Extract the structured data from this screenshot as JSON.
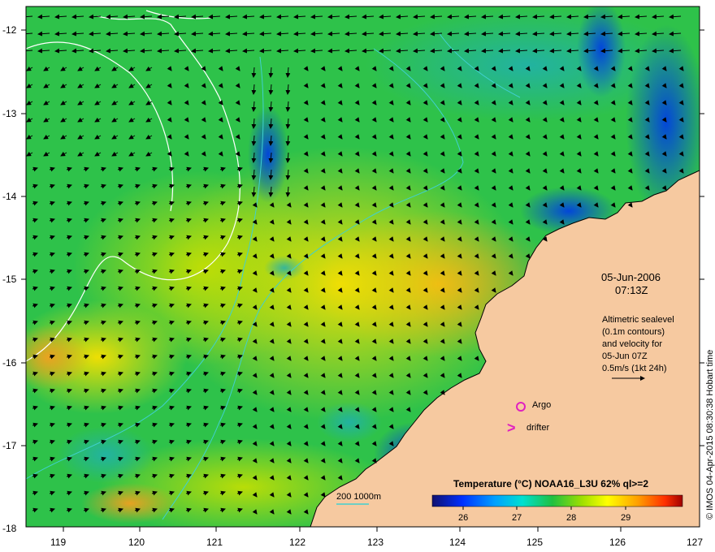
{
  "map": {
    "lat_ticks": [
      "-12",
      "-13",
      "-14",
      "-15",
      "-16",
      "-17",
      "-18"
    ],
    "lon_ticks": [
      "119",
      "120",
      "121",
      "122",
      "123",
      "124",
      "125",
      "126",
      "127"
    ],
    "date": "05-Jun-2006",
    "time": "07:13Z",
    "info_lines": [
      "Altimetric sealevel",
      "(0.1m contours)",
      "and velocity for",
      "05-Jun 07Z",
      "0.5m/s (1kt 24h)"
    ],
    "argo_label": "Argo",
    "drifter_label": "drifter",
    "depth_legend": "200  1000m",
    "colorbar_title": "Temperature (°C) NOAA16_L3U 62% ql>=2",
    "colorbar_ticks": [
      "26",
      "27",
      "28",
      "29"
    ],
    "credit": "© IMOS 04-Apr-2015 08:30:38 Hobart time",
    "colors": {
      "land": "#f6c9a0",
      "argo": "#e020c0",
      "drifter": "#e020c0",
      "depth_contour": "#40d0d0",
      "sealevel_contour": "#ffffff"
    }
  }
}
